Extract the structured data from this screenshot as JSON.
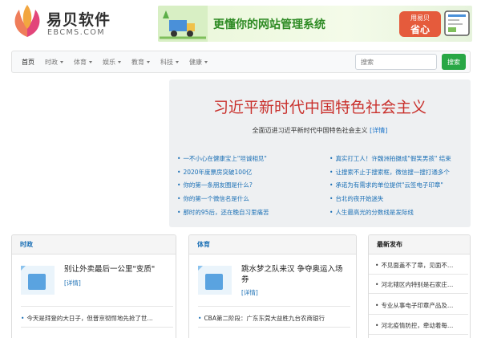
{
  "logo": {
    "name": "易贝软件",
    "sub": "EBCMS.COM"
  },
  "banner": {
    "title": "更懂你的网站管理系统",
    "badge_line1": "用易贝",
    "badge_line2": "省心"
  },
  "nav": {
    "items": [
      {
        "label": "首页",
        "active": true,
        "dropdown": false
      },
      {
        "label": "时政",
        "active": false,
        "dropdown": true
      },
      {
        "label": "体育",
        "active": false,
        "dropdown": true
      },
      {
        "label": "娱乐",
        "active": false,
        "dropdown": true
      },
      {
        "label": "教育",
        "active": false,
        "dropdown": true
      },
      {
        "label": "科技",
        "active": false,
        "dropdown": true
      },
      {
        "label": "健康",
        "active": false,
        "dropdown": true
      }
    ],
    "search_placeholder": "搜索",
    "search_button": "搜索"
  },
  "hero": {
    "title": "习近平新时代中国特色社会主义",
    "subtitle": "全面迈进习近平新时代中国特色社会主义",
    "detail": "[详情]",
    "links_left": [
      "一不小心在健康宝上\"坦诚相见\"",
      "2020年度票房突破100亿",
      "你的第一条朋友圈是什么?",
      "你的第一个微信名是什么",
      "那时的95后，还在晚自习里痛苦"
    ],
    "links_right": [
      "真实打工人！许魏洲拍摄成\"假笑男孩\" 结束",
      "让搜索不止于搜索框，微信搜一搜打通多个",
      "承诺为有需求的单位提供\"云签电子印章\"",
      "台北的夜开始迷失",
      "人生最高光的分数线是发际线"
    ]
  },
  "cards": {
    "politics": {
      "header": "时政",
      "feature_title": "别让外卖最后一公里\"变质\"",
      "feature_detail": "[详情]",
      "items": [
        "今天是拜登的大日子，但普京彻悍地先抢了世…"
      ]
    },
    "sports": {
      "header": "体育",
      "feature_title": "跳水梦之队来汉 争夺奥运入场券",
      "feature_detail": "[详情]",
      "items": [
        "CBA第二阶段：广东东莞大益胜九台农商银行"
      ]
    },
    "latest": {
      "header": "最新发布",
      "items": [
        "不见面盖不了章，见面不…",
        "河北辖区内特别是石家庄…",
        "专业从事电子印章产品及…",
        "河北疫情防控，牵动着每…"
      ]
    }
  },
  "colors": {
    "accent_green": "#28a745",
    "hero_red": "#c9302c",
    "link_blue": "#1a6fb5"
  }
}
